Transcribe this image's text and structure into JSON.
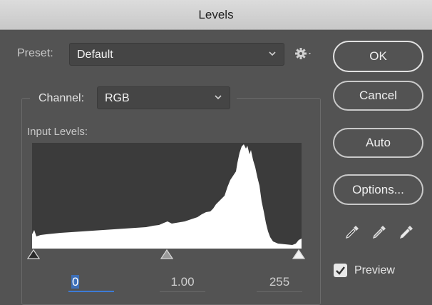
{
  "window": {
    "title": "Levels"
  },
  "preset": {
    "label": "Preset:",
    "value": "Default"
  },
  "channel": {
    "label": "Channel:",
    "value": "RGB"
  },
  "input_levels": {
    "label": "Input Levels:",
    "black": "0",
    "gamma": "1.00",
    "white": "255"
  },
  "buttons": {
    "ok": "OK",
    "cancel": "Cancel",
    "auto": "Auto",
    "options": "Options..."
  },
  "preview": {
    "label": "Preview",
    "checked": true
  },
  "colors": {
    "dialog_bg": "#535353",
    "histogram_bg": "#3b3b3b",
    "histogram_fill": "#ffffff",
    "selection_blue": "#3d6fb8"
  }
}
